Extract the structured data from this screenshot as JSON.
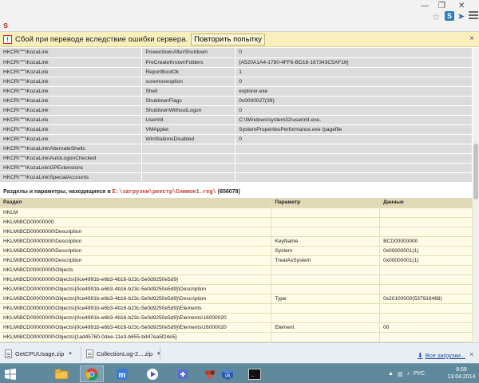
{
  "infobar": {
    "message": "Сбой при переводе вследствие ошибки сервера.",
    "retry_label": "Повторить попытку",
    "close_glyph": "×",
    "icon": "warning-icon"
  },
  "registry_table_1": {
    "rows": [
      [
        "HKCR\\\"\"\"\\KozaLink",
        "PowerdownAfterShutdown",
        "0"
      ],
      [
        "HKCR\\\"\"\"\\KozaLink",
        "PreCreateKnownFolders",
        "{A520A1A4-1780-4FF6-BD18-167343C5AF16}"
      ],
      [
        "HKCR\\\"\"\"\\KozaLink",
        "ReportBootOk",
        "1"
      ],
      [
        "HKCR\\\"\"\"\\KozaLink",
        "scremoveoption",
        "0"
      ],
      [
        "HKCR\\\"\"\"\\KozaLink",
        "Shell",
        "explorer.exe"
      ],
      [
        "HKCR\\\"\"\"\\KozaLink",
        "ShutdownFlags",
        "0x0000027(39)"
      ],
      [
        "HKCR\\\"\"\"\\KozaLink",
        "ShutdownWithoutLogon",
        "0"
      ],
      [
        "HKCR\\\"\"\"\\KozaLink",
        "Userinit",
        "C:\\Windows\\system32\\userinit.exe,"
      ],
      [
        "HKCR\\\"\"\"\\KozaLink",
        "VMApplet",
        "SystemPropertiesPerformance.exe /pagefile"
      ],
      [
        "HKCR\\\"\"\"\\KozaLink",
        "WinStationsDisabled",
        "0"
      ],
      [
        "HKCR\\\"\"\"\\KozaLink\\AlternateShells",
        "",
        ""
      ],
      [
        "HKCR\\\"\"\"\\KozaLink\\AutoLogonChecked",
        "",
        ""
      ],
      [
        "HKCR\\\"\"\"\\KozaLink\\GPExtensions",
        "",
        ""
      ],
      [
        "HKCR\\\"\"\"\\KozaLink\\SpecialAccounts",
        "",
        ""
      ]
    ]
  },
  "section": {
    "title_prefix": "Разделы и параметры, находящиеся в ",
    "path": "E:\\загрузки\\реестр\\Снимок1.reg\\",
    "count": " (656078)"
  },
  "registry_table_2": {
    "headers": [
      "Раздел",
      "Параметр",
      "Данные"
    ],
    "rows": [
      [
        "HKLM",
        "",
        ""
      ],
      [
        "HKLM\\BCD00000000",
        "",
        ""
      ],
      [
        "HKLM\\BCD00000000\\Description",
        "",
        ""
      ],
      [
        "HKLM\\BCD00000000\\Description",
        "KeyName",
        "BCD00000000"
      ],
      [
        "HKLM\\BCD00000000\\Description",
        "System",
        "0x00000001(1)"
      ],
      [
        "HKLM\\BCD00000000\\Description",
        "TreatAsSystem",
        "0x00000001(1)"
      ],
      [
        "HKLM\\BCD00000000\\Objects",
        "",
        ""
      ],
      [
        "HKLM\\BCD00000000\\Objects\\{0ce4991b-e6b3-4b16-b23c-5e0d9250e5d9}",
        "",
        ""
      ],
      [
        "HKLM\\BCD00000000\\Objects\\{0ce4991b-e6b3-4b16-b23c-5e0d9250e5d9}\\Description",
        "",
        ""
      ],
      [
        "HKLM\\BCD00000000\\Objects\\{0ce4991b-e6b3-4b16-b23c-5e0d9250e5d9}\\Description",
        "Type",
        "0x20100000(537919488)"
      ],
      [
        "HKLM\\BCD00000000\\Objects\\{0ce4991b-e6b3-4b16-b23c-5e0d9250e5d9}\\Elements",
        "",
        ""
      ],
      [
        "HKLM\\BCD00000000\\Objects\\{0ce4991b-e6b3-4b16-b23c-5e0d9250e5d9}\\Elements\\16000020",
        "",
        ""
      ],
      [
        "HKLM\\BCD00000000\\Objects\\{0ce4991b-e6b3-4b16-b23c-5e0d9250e5d9}\\Elements\\16000020",
        "Element",
        "00"
      ],
      [
        "HKLM\\BCD00000000\\Objects\\{1ad45760-0dee-11e3-b655-bd47ea5f24e5}",
        "",
        ""
      ]
    ]
  },
  "downloads": {
    "items": [
      "GetCPUUsage.zip",
      "CollectionLog-2....zip"
    ],
    "all_label": "Все загрузки...",
    "close_glyph": "×"
  },
  "taskbar": {
    "apps": [
      "start-icon",
      "explorer-icon",
      "chrome-icon",
      "maxthon-icon",
      "media-player-icon",
      "app-icon",
      "game-icon",
      "virtualbox-icon",
      "terminal-icon"
    ],
    "tray_lang": "РУС",
    "clock_time": "8:59",
    "clock_date": "13.04.2014"
  }
}
